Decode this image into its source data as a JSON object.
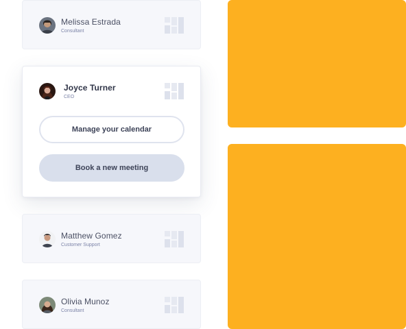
{
  "contacts": [
    {
      "name": "Melissa Estrada",
      "role": "Consultant",
      "avatar": "avatar-photo"
    },
    {
      "name": "Joyce Turner",
      "role": "CEO",
      "avatar": "avatar-photo"
    },
    {
      "name": "Matthew Gomez",
      "role": "Customer Support",
      "avatar": "avatar-photo"
    },
    {
      "name": "Olivia Munoz",
      "role": "Consultant",
      "avatar": "avatar-photo"
    }
  ],
  "actions": {
    "manage_calendar": "Manage your calendar",
    "book_meeting": "Book a new meeting"
  },
  "icons": {
    "stats": "bar-chart-icon"
  },
  "colors": {
    "accent_panel": "#fdb020",
    "card_bg": "#f6f7fb",
    "button_filled": "#d9dfec",
    "button_outline_border": "#dfe3ee",
    "role_text": "#7c84a8"
  }
}
